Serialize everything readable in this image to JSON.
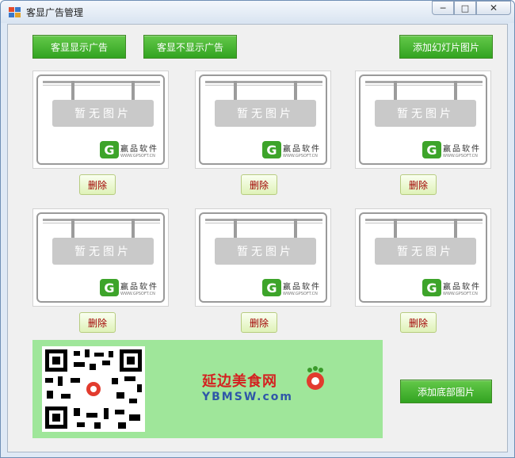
{
  "window": {
    "title": "客显广告管理",
    "controls": {
      "minimize": "─",
      "maximize": "□",
      "close": "✕"
    }
  },
  "toolbar": {
    "show_ads": "客显显示广告",
    "hide_ads": "客显不显示广告",
    "add_slides": "添加幻灯片图片"
  },
  "slots": [
    {
      "placeholder": "暂无图片",
      "brand": "赢品软件",
      "url": "WWW.GPSOFT.CN",
      "delete": "删除"
    },
    {
      "placeholder": "暂无图片",
      "brand": "赢品软件",
      "url": "WWW.GPSOFT.CN",
      "delete": "删除"
    },
    {
      "placeholder": "暂无图片",
      "brand": "赢品软件",
      "url": "WWW.GPSOFT.CN",
      "delete": "删除"
    },
    {
      "placeholder": "暂无图片",
      "brand": "赢品软件",
      "url": "WWW.GPSOFT.CN",
      "delete": "删除"
    },
    {
      "placeholder": "暂无图片",
      "brand": "赢品软件",
      "url": "WWW.GPSOFT.CN",
      "delete": "删除"
    },
    {
      "placeholder": "暂无图片",
      "brand": "赢品软件",
      "url": "WWW.GPSOFT.CN",
      "delete": "删除"
    }
  ],
  "bottom": {
    "site_cn": "延边美食网",
    "site_en": "YBMSW.com",
    "add_bottom": "添加底部图片"
  },
  "colors": {
    "button_green": "#3aa626",
    "banner_green": "#9fe69a",
    "delete_text": "#a00000"
  }
}
